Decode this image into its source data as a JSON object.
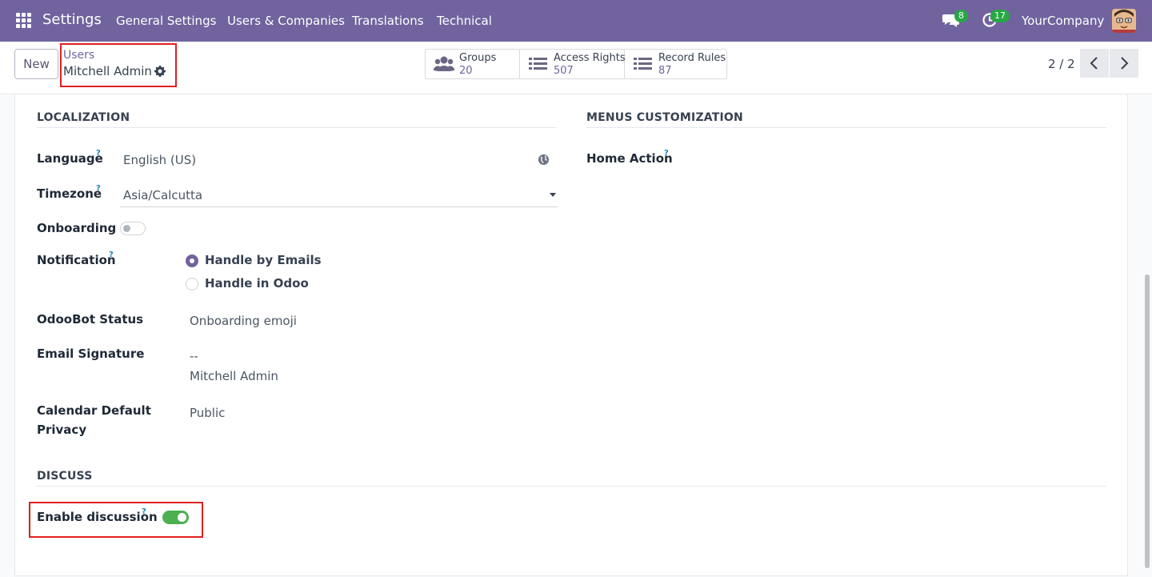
{
  "navbar": {
    "app_name": "Settings",
    "menu": [
      "General Settings",
      "Users & Companies",
      "Translations",
      "Technical"
    ],
    "messages_badge": "8",
    "activities_badge": "17",
    "company": "YourCompany"
  },
  "control_panel": {
    "new_label": "New",
    "breadcrumb_parent": "Users",
    "breadcrumb_current": "Mitchell Admin",
    "smart_buttons": [
      {
        "label": "Groups",
        "value": "20",
        "icon": "users-icon"
      },
      {
        "label": "Access Rights",
        "value": "507",
        "icon": "list-icon"
      },
      {
        "label": "Record Rules",
        "value": "87",
        "icon": "list-icon"
      }
    ],
    "pager": "2 / 2"
  },
  "form": {
    "localization": {
      "title": "LOCALIZATION",
      "language_label": "Language",
      "language_value": "English (US)",
      "timezone_label": "Timezone",
      "timezone_value": "Asia/Calcutta",
      "onboarding_label": "Onboarding",
      "onboarding_enabled": false,
      "notification_label": "Notification",
      "notification_options": [
        "Handle by Emails",
        "Handle in Odoo"
      ],
      "notification_selected": "Handle by Emails",
      "odoobot_label": "OdooBot Status",
      "odoobot_value": "Onboarding emoji",
      "signature_label": "Email Signature",
      "signature_line1": "--",
      "signature_line2": "Mitchell Admin",
      "calendar_label_line1": "Calendar Default",
      "calendar_label_line2": "Privacy",
      "calendar_value": "Public"
    },
    "menus": {
      "title": "MENUS CUSTOMIZATION",
      "home_action_label": "Home Action",
      "home_action_value": ""
    },
    "discuss": {
      "title": "DISCUSS",
      "enable_label": "Enable discussion",
      "enable_value": true
    },
    "help_mark": "?"
  },
  "colors": {
    "brand": "#71639e",
    "toggle_on": "#4caf50",
    "highlight": "#e02020"
  }
}
